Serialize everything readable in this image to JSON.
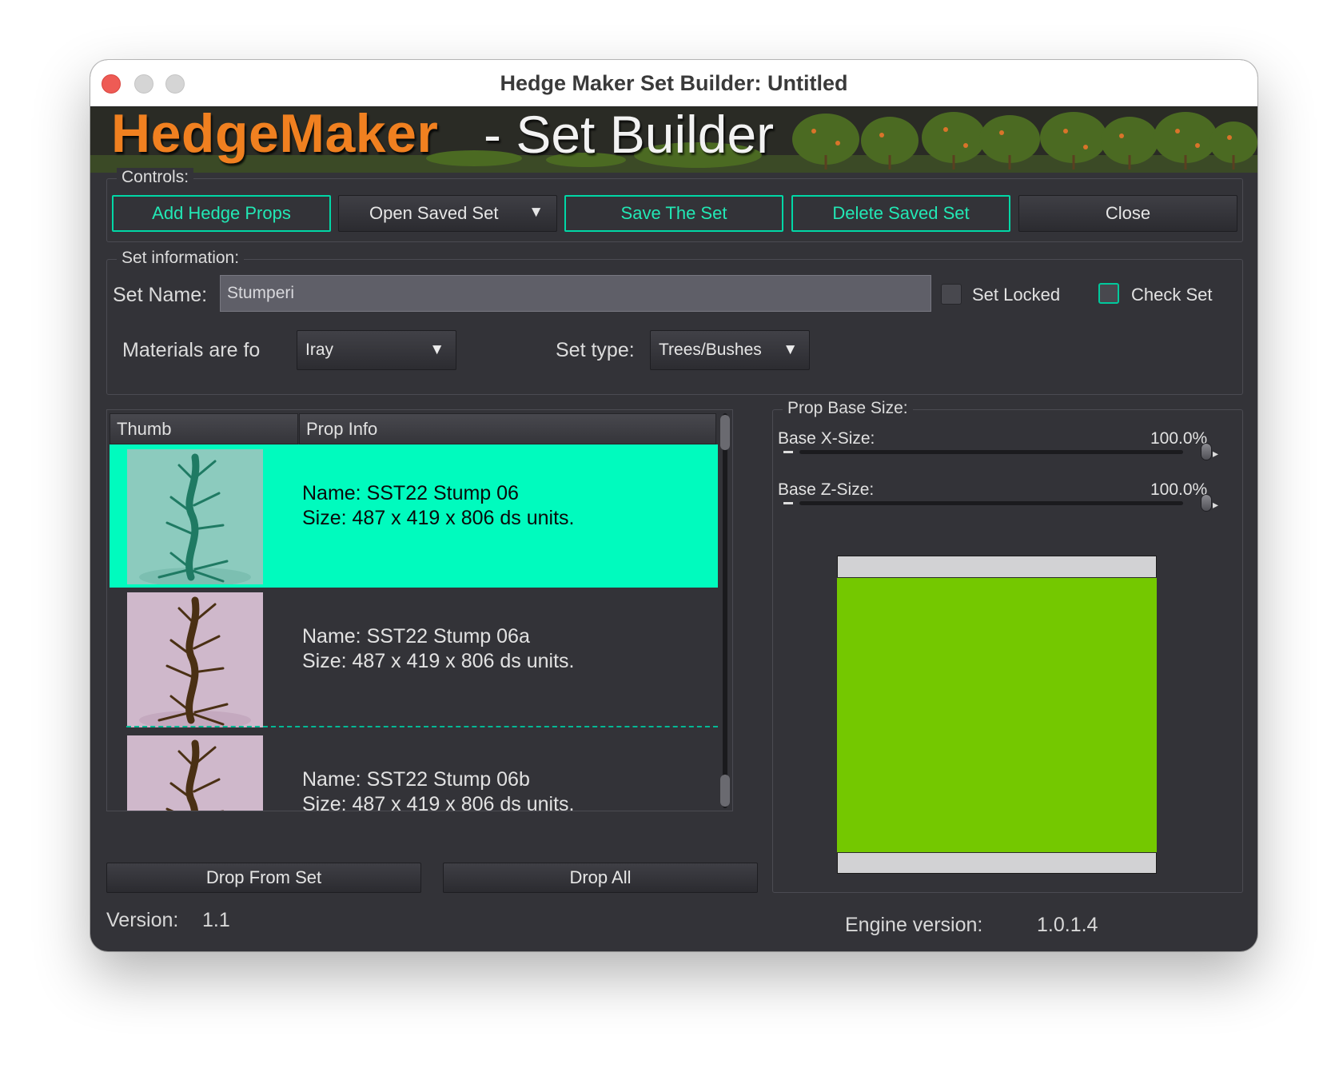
{
  "window": {
    "title": "Hedge Maker Set Builder: Untitled"
  },
  "banner": {
    "logo": "HedgeMaker",
    "subtitle": "- Set Builder"
  },
  "controls": {
    "legend": "Controls:",
    "add_hedge_props": "Add Hedge Props",
    "open_saved_set": "Open Saved Set",
    "save_the_set": "Save The Set",
    "delete_saved_set": "Delete Saved Set",
    "close": "Close"
  },
  "set_info": {
    "legend": "Set information:",
    "set_name_label": "Set Name:",
    "set_name_value": "Stumperi",
    "set_locked_label": "Set Locked",
    "set_locked_checked": false,
    "check_set_label": "Check Set",
    "check_set_checked": false,
    "materials_label": "Materials are fo",
    "materials_value": "Iray",
    "set_type_label": "Set type:",
    "set_type_value": "Trees/Bushes"
  },
  "prop_list": {
    "columns": [
      "Thumb",
      "Prop Info"
    ],
    "rows": [
      {
        "name": "Name: SST22 Stump 06",
        "size": "Size: 487 x 419 x 806 ds units.",
        "selected": true,
        "thumb_bg": "#8ccbbe",
        "trunk_color": "#1f7a63"
      },
      {
        "name": "Name: SST22 Stump 06a",
        "size": "Size: 487 x 419 x 806 ds units.",
        "selected": false,
        "thumb_bg": "#cfb8cb",
        "trunk_color": "#4a3014"
      },
      {
        "name": "Name: SST22 Stump 06b",
        "size": "Size: 487 x 419 x 806 ds units.",
        "selected": false,
        "thumb_bg": "#cfb8cb",
        "trunk_color": "#4a3014"
      }
    ]
  },
  "list_buttons": {
    "drop_from_set": "Drop From Set",
    "drop_all": "Drop All"
  },
  "prop_base": {
    "legend": "Prop Base Size:",
    "x_label": "Base X-Size:",
    "x_value": "100.0%",
    "z_label": "Base Z-Size:",
    "z_value": "100.0%",
    "preview_color": "#74c800"
  },
  "footer": {
    "version_label": "Version:",
    "version_value": "1.1",
    "engine_label": "Engine version:",
    "engine_value": "1.0.1.4"
  },
  "colors": {
    "accent": "#00d7a6",
    "selected_row": "#00fbbe",
    "logo_orange": "#f08020"
  },
  "icons": [
    "close-window-icon",
    "minimize-window-icon",
    "maximize-window-icon",
    "dropdown-arrow-icon",
    "slider-minus-icon",
    "slider-plus-icon"
  ]
}
